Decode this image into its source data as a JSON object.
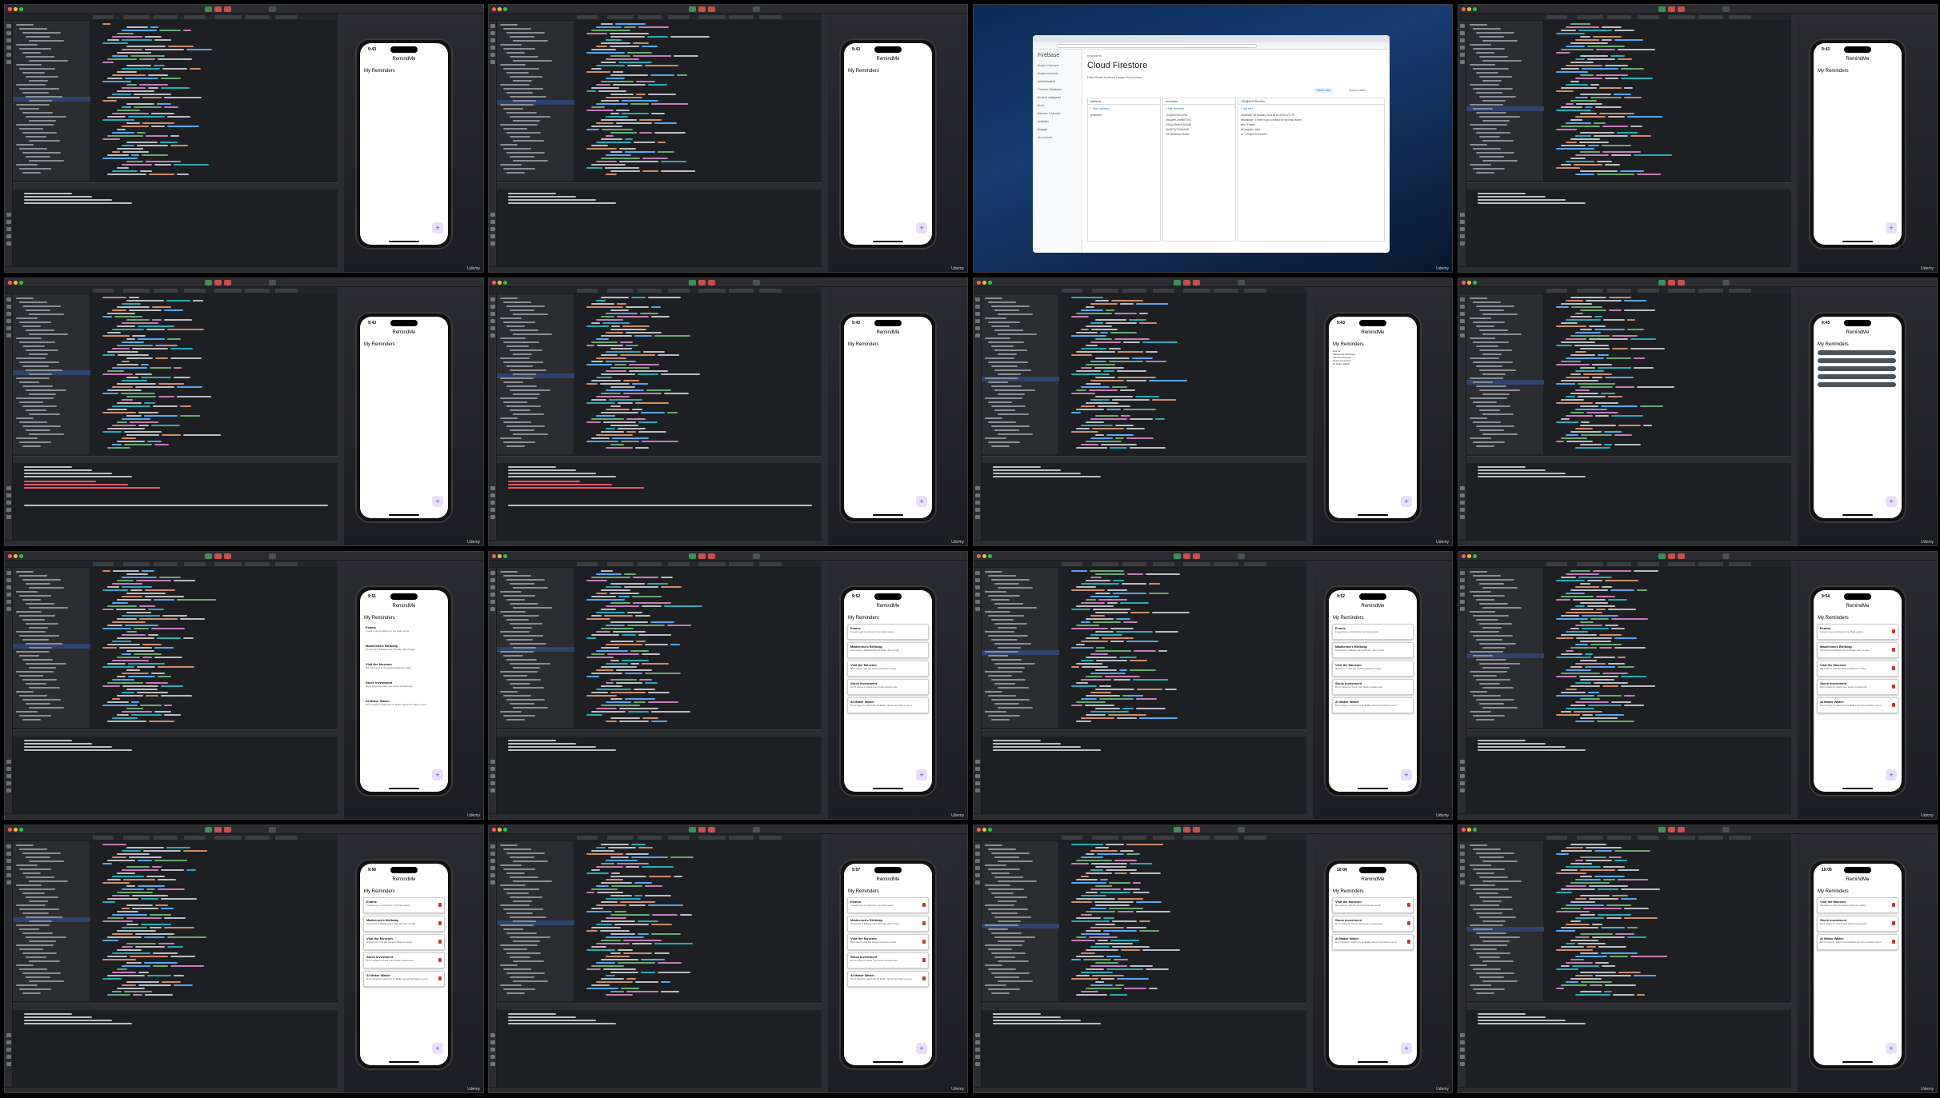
{
  "watermark": "Udemy",
  "phone": {
    "app_title": "RemindMe",
    "list_title": "My Reminders",
    "fab_label": "+",
    "times": [
      "9:43",
      "9:43",
      "",
      "9:43",
      "9:43",
      "9:43",
      "9:43",
      "9:43",
      "9:51",
      "9:52",
      "9:52",
      "9:54",
      "9:56",
      "9:57",
      "10:04",
      "10:05"
    ]
  },
  "reminders": [
    {
      "title": "Exams",
      "description": "I need to go to school for my final exams"
    },
    {
      "title": "Madeenna's Birthday",
      "description": "Tomorrow is Madeenna's birthday, don't forget"
    },
    {
      "title": "Visit the Museum",
      "description": "We have to visit the ancient Museum today"
    },
    {
      "title": "Stock investment",
      "description": "Don't forget to check your stock investments"
    },
    {
      "title": "AI Maker Watch",
      "description": "Don't forget to watch the AI Maker launch at today's event"
    }
  ],
  "firestore": {
    "brand": "Firebase",
    "project": "remindme",
    "title": "Cloud Firestore",
    "tabs": "Data   Rules   Indexes   Usage   Extensions",
    "sidebar_items": [
      "Project Overview",
      "Project shortcuts",
      "Authentication",
      "Firestore Database",
      "Product categories",
      "Build",
      "Release & Monitor",
      "Analytics",
      "Engage",
      "All products"
    ],
    "panel1_header": "(default)",
    "panel2_header": "reminders",
    "panel3_header": "7Zk3jhDYi7Ks1Vbs",
    "start_collection": "+ Start collection",
    "add_document": "+ Add document",
    "add_field": "+ Add field",
    "panel1_rows": [
      "reminders"
    ],
    "panel2_rows": [
      "7Zk3jhDYi7Ks1Vbs",
      "A9sQwPL2mR8xT4nC",
      "H2kLpO9vBnM3xZqW",
      "Qw3ErTy7UiOpAsDf",
      "ZxCvBnM1LkJhGfDs"
    ],
    "panel3_rows": [
      "createdAt: 29 January 2024 at 12:30:45 UTC+5",
      "description: \"I need to go to school for my final exams\"",
      "title: \"Exams\"",
      "isComplete: false",
      "id: \"7Zk3jhDYi7Ks1Vbs\""
    ],
    "panel_button_1": "Panel view",
    "panel_button_2": "Query builder"
  }
}
